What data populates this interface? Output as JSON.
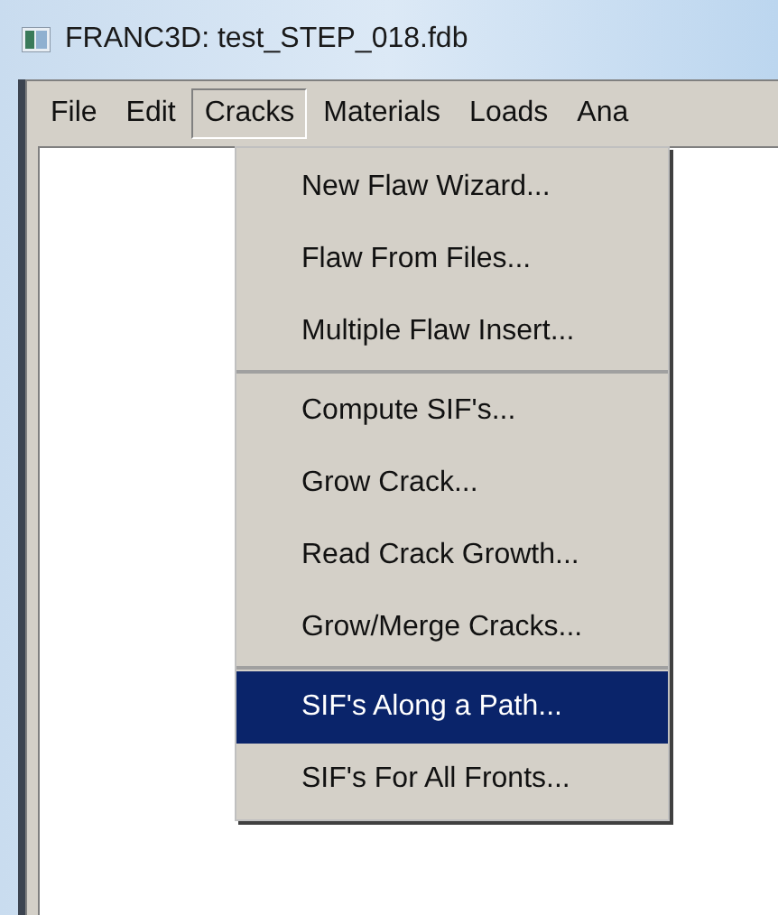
{
  "window": {
    "title": "FRANC3D:  test_STEP_018.fdb"
  },
  "menu_bar": [
    {
      "label": "File",
      "selected": false
    },
    {
      "label": "Edit",
      "selected": false
    },
    {
      "label": "Cracks",
      "selected": true
    },
    {
      "label": "Materials",
      "selected": false
    },
    {
      "label": "Loads",
      "selected": false
    },
    {
      "label": "Ana",
      "selected": false
    }
  ],
  "dropdown": {
    "groups": [
      [
        {
          "label": "New Flaw Wizard...",
          "selected": false
        },
        {
          "label": "Flaw From Files...",
          "selected": false
        },
        {
          "label": "Multiple Flaw Insert...",
          "selected": false
        }
      ],
      [
        {
          "label": "Compute SIF's...",
          "selected": false
        },
        {
          "label": "Grow Crack...",
          "selected": false
        },
        {
          "label": "Read Crack Growth...",
          "selected": false
        },
        {
          "label": "Grow/Merge Cracks...",
          "selected": false
        }
      ],
      [
        {
          "label": "SIF's Along a Path...",
          "selected": true
        },
        {
          "label": "SIF's For All Fronts...",
          "selected": false
        }
      ]
    ]
  }
}
